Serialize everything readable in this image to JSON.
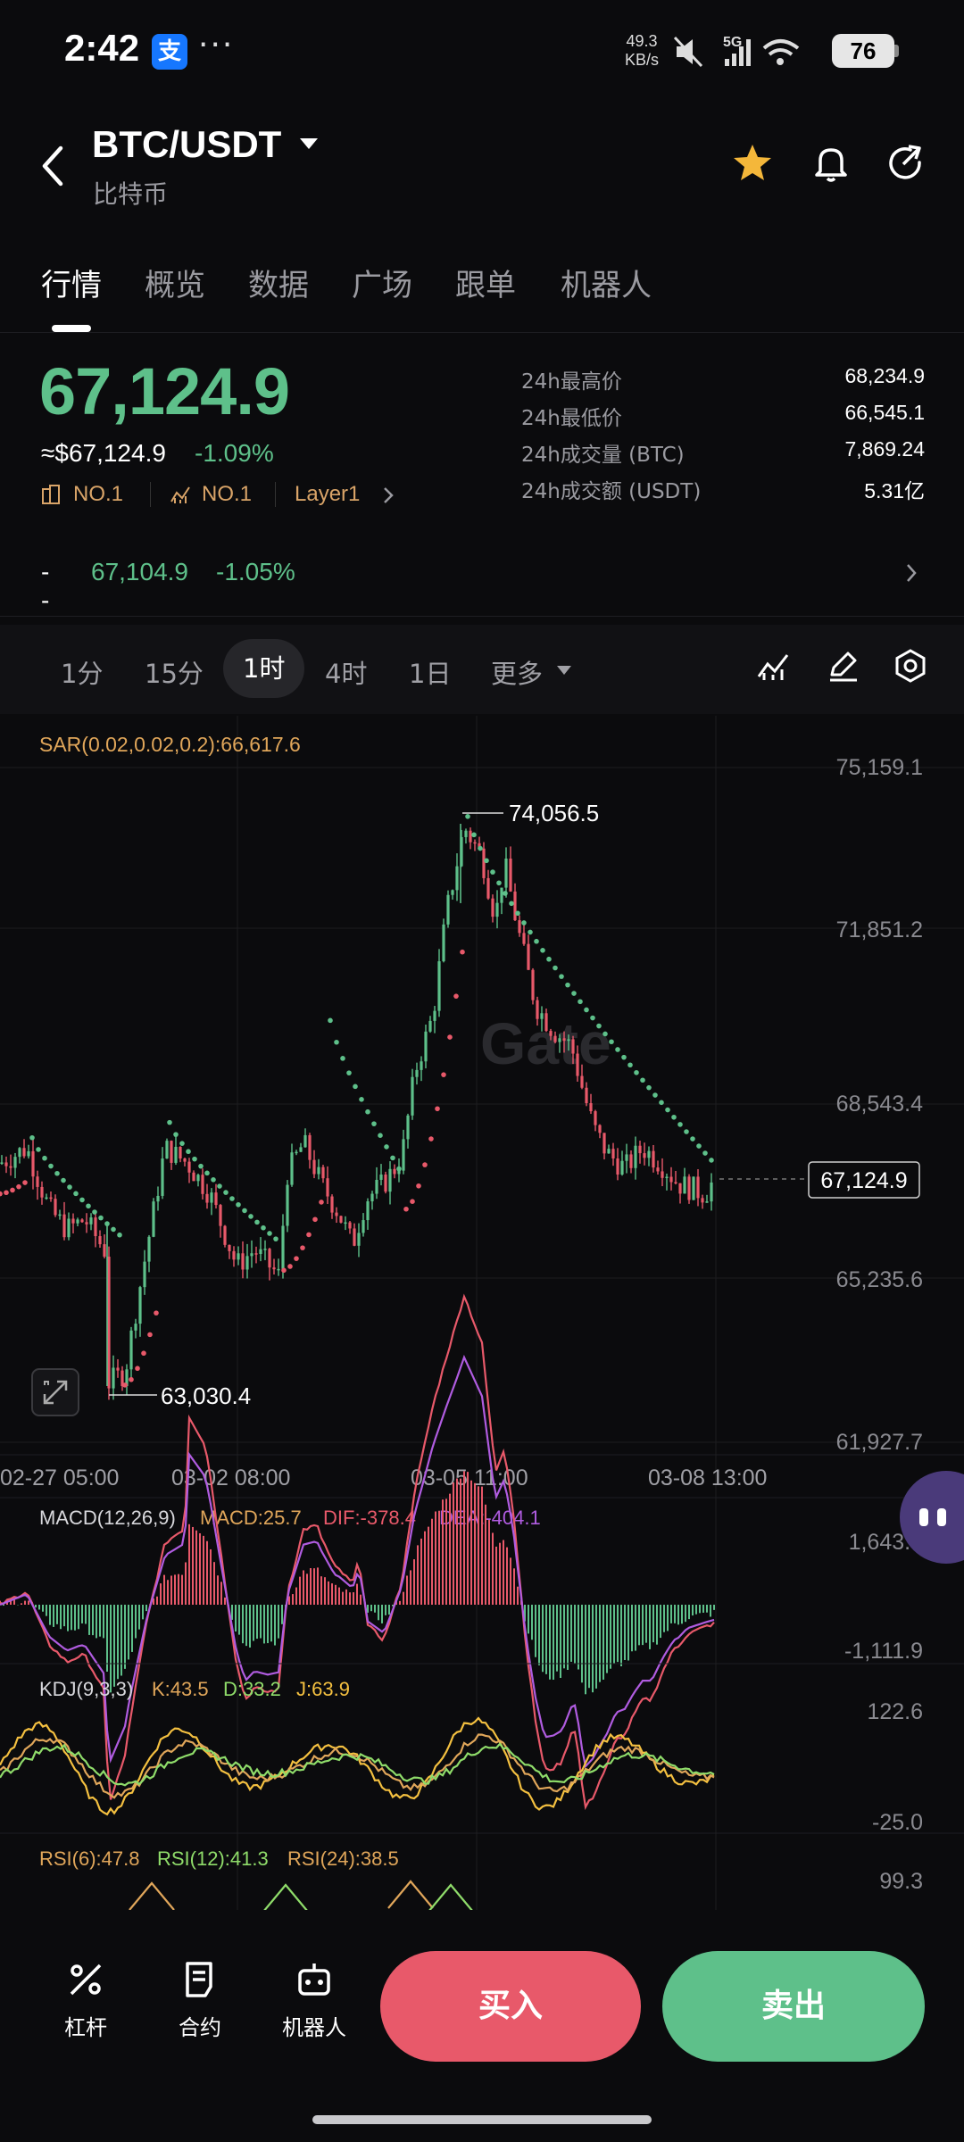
{
  "status_bar": {
    "time": "2:42",
    "app_badge": "支",
    "more": "···",
    "net_speed_value": "49.3",
    "net_speed_unit": "KB/s",
    "network": "5G",
    "battery": "76"
  },
  "header": {
    "pair": "BTC/USDT",
    "subtitle": "比特币"
  },
  "tabs": [
    "行情",
    "概览",
    "数据",
    "广场",
    "跟单",
    "机器人"
  ],
  "price": {
    "last": "67,124.9",
    "usd": "≈$67,124.9",
    "change": "-1.09%",
    "rank1": "NO.1",
    "rank2": "NO.1",
    "category": "Layer1",
    "mark_prefix": "--",
    "mark_price": "67,104.9",
    "mark_change": "-1.05%"
  },
  "stats": [
    {
      "label": "24h最高价",
      "value": "68,234.9"
    },
    {
      "label": "24h最低价",
      "value": "66,545.1"
    },
    {
      "label": "24h成交量 (BTC)",
      "value": "7,869.24"
    },
    {
      "label": "24h成交额 (USDT)",
      "value": "5.31亿"
    }
  ],
  "intervals": [
    "1分",
    "15分",
    "1时",
    "4时",
    "1日",
    "更多"
  ],
  "intervals_active": "1时",
  "chart": {
    "sar_label": "SAR(0.02,0.02,0.2):66,617.6",
    "watermark": "Gate",
    "y_ticks": [
      "75,159.1",
      "71,851.2",
      "68,543.4",
      "65,235.6",
      "61,927.7"
    ],
    "high_label": "74,056.5",
    "low_label": "63,030.4",
    "current_label": "67,124.9",
    "x_ticks": [
      "02-27 05:00",
      "03-02 08:00",
      "03-05 11:00",
      "03-08 13:00"
    ],
    "macd_params": "MACD(12,26,9)",
    "macd_val": "MACD:25.7",
    "dif_val": "DIF:-378.4",
    "dea_val": "DEA:-404.1",
    "macd_max": "1,643.7",
    "macd_min": "-1,111.9",
    "kdj_params": "KDJ(9,3,3)",
    "kdj_k": "K:43.5",
    "kdj_d": "D:33.2",
    "kdj_j": "J:63.9",
    "kdj_max": "122.6",
    "kdj_min": "-25.0",
    "rsi6": "RSI(6):47.8",
    "rsi12": "RSI(12):41.3",
    "rsi24": "RSI(24):38.5",
    "rsi_max": "99.3"
  },
  "chart_data": {
    "type": "candlestick",
    "ylim": [
      61927.7,
      75159.1
    ],
    "x_ticks": [
      "02-27 05:00",
      "03-02 08:00",
      "03-05 11:00",
      "03-08 13:00"
    ],
    "high": 74056.5,
    "low": 63030.4,
    "last": 67124.9,
    "sar": 66617.6
  },
  "bottom": {
    "leverage": "杠杆",
    "contract": "合约",
    "bot": "机器人",
    "buy": "买入",
    "sell": "卖出"
  },
  "colors": {
    "up": "#5ec08a",
    "down": "#e8596a",
    "accent": "#f4b73a"
  }
}
